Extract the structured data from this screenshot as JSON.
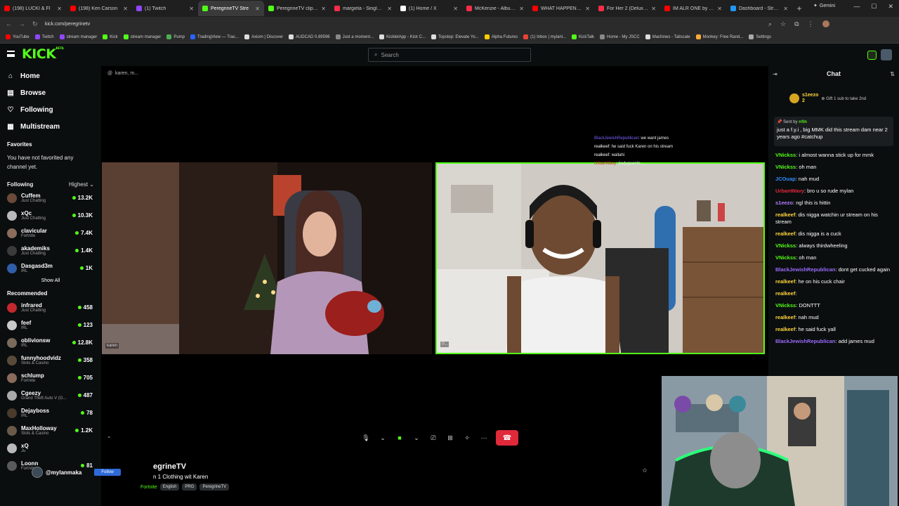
{
  "browser": {
    "tabs": [
      {
        "title": "(198) LUCKI & FI",
        "color": "#ff0000"
      },
      {
        "title": "(198) Ken Carson",
        "color": "#ff0000"
      },
      {
        "title": "(1) Twitch",
        "color": "#9146ff"
      },
      {
        "title": "PeregrineTV Stre",
        "color": "#53fc18",
        "active": true
      },
      {
        "title": "PeregrineTV clipped",
        "color": "#53fc18"
      },
      {
        "title": "margiela - Single - Al",
        "color": "#fa2d48"
      },
      {
        "title": "(1) Home / X",
        "color": "#ffffff"
      },
      {
        "title": "McKenzie - Album by",
        "color": "#fa2d48"
      },
      {
        "title": "WHAT HAPPENED TO",
        "color": "#ff0000"
      },
      {
        "title": "For Her 2 (Deluxe) -",
        "color": "#fa2d48"
      },
      {
        "title": "IM ALR ONE by mylan",
        "color": "#ff0000"
      },
      {
        "title": "Dashboard - Stream",
        "color": "#2196f3"
      }
    ],
    "gemini_label": "Gemini",
    "url": "kick.com/peregrinetv",
    "bookmarks": [
      {
        "label": "YouTube",
        "color": "#ff0000"
      },
      {
        "label": "Twitch",
        "color": "#9146ff"
      },
      {
        "label": "stream manager",
        "color": "#9146ff"
      },
      {
        "label": "Kick",
        "color": "#53fc18"
      },
      {
        "label": "stream manager",
        "color": "#53fc18"
      },
      {
        "label": "Pump",
        "color": "#4caf50"
      },
      {
        "label": "TradingView — Trac...",
        "color": "#2962ff"
      },
      {
        "label": "Axiom | Discover",
        "color": "#dddddd"
      },
      {
        "label": "AUDCAD 0.89596",
        "color": "#dddddd"
      },
      {
        "label": "Just a moment...",
        "color": "#888888"
      },
      {
        "label": "KickletApp - Kick C...",
        "color": "#dddddd"
      },
      {
        "label": "Topstep: Elevate Yo...",
        "color": "#dddddd"
      },
      {
        "label": "Alpha Futures",
        "color": "#ffcc00"
      },
      {
        "label": "(1) Inbox | mylanl...",
        "color": "#ea4335"
      },
      {
        "label": "KickTalk",
        "color": "#53fc18"
      },
      {
        "label": "Home - My JSCC",
        "color": "#888888"
      },
      {
        "label": "Machines - Tailscale",
        "color": "#dddddd"
      },
      {
        "label": "Monkey: Free Rand...",
        "color": "#ffaa33"
      },
      {
        "label": "Settings",
        "color": "#aaaaaa"
      }
    ]
  },
  "header": {
    "logo": "KICK",
    "logo_beta": "BETA",
    "search_placeholder": "Search"
  },
  "sidebar": {
    "nav": [
      {
        "label": "Home",
        "icon": "home-icon"
      },
      {
        "label": "Browse",
        "icon": "browse-icon"
      },
      {
        "label": "Following",
        "icon": "heart-icon"
      },
      {
        "label": "Multistream",
        "icon": "multistream-icon"
      }
    ],
    "favorites_title": "Favorites",
    "favorites_note": "You have not favorited any channel yet.",
    "following_title": "Following",
    "following_sort": "Highest",
    "following": [
      {
        "name": "Cuffem",
        "category": "Just Chatting",
        "viewers": "13.2K",
        "color": "#6b4a3a"
      },
      {
        "name": "xQc",
        "category": "Just Chatting",
        "viewers": "10.3K",
        "color": "#b9b9b9"
      },
      {
        "name": "clavicular",
        "category": "Fortnite",
        "viewers": "7.4K",
        "color": "#8a6d5a"
      },
      {
        "name": "akademiks",
        "category": "Just Chatting",
        "viewers": "1.4K",
        "color": "#3b3b3b"
      },
      {
        "name": "Dasgasd3m",
        "category": "IRL",
        "viewers": "1K",
        "color": "#2f5ea8"
      }
    ],
    "show_all": "Show All",
    "recommended_title": "Recommended",
    "recommended": [
      {
        "name": "infrared",
        "category": "Just Chatting",
        "viewers": "458",
        "color": "#c2282d"
      },
      {
        "name": "feef",
        "category": "IRL",
        "viewers": "123",
        "color": "#c9c9c9"
      },
      {
        "name": "oblivionsw",
        "category": "IRL",
        "viewers": "12.8K",
        "color": "#7a6a5a"
      },
      {
        "name": "funnyhoodvidz",
        "category": "Slots & Casino",
        "viewers": "358",
        "color": "#5a4a3a"
      },
      {
        "name": "schlump",
        "category": "Fortnite",
        "viewers": "705",
        "color": "#8a6a5a"
      },
      {
        "name": "Cgeezy",
        "category": "Grand Theft Auto V (G...",
        "viewers": "487",
        "color": "#aaaaaa"
      },
      {
        "name": "Dejayboss",
        "category": "IRL",
        "viewers": "78",
        "color": "#4a3a2a"
      },
      {
        "name": "MaxHolloway",
        "category": "Slots & Casino",
        "viewers": "1.2K",
        "color": "#6a5a4a"
      },
      {
        "name": "xQ",
        "category": "Ju",
        "viewers": "",
        "color": "#b9b9b9"
      },
      {
        "name": "Loonn",
        "category": "Fortnite",
        "viewers": "81",
        "color": "#5a5a5a"
      }
    ]
  },
  "main": {
    "call_title": "karen, m...",
    "feed_left_label": "karen",
    "feed_right_label": "P...",
    "overlay_chat": [
      {
        "user": "BlackJewishRepublican",
        "text": ": we want james",
        "color": "#7b61ff"
      },
      {
        "user": "realkeef",
        "text": ": he said fuck Karen on his stream",
        "color": "#ffffff"
      },
      {
        "user": "realkeef",
        "text": ": wallahi",
        "color": "#ffffff"
      },
      {
        "user": "UrbanWavy",
        "text": ": bodyguards ...",
        "color": "#e0293a"
      }
    ],
    "streamer_name": "egrineTV",
    "stream_title": "n 1 Clothing wit Karen",
    "category": "Fortnite",
    "tags": [
      "English",
      "PRG",
      "PeregrineTV"
    ],
    "mylan_handle": "@mylanmaka",
    "follow_label": "Follow"
  },
  "chat": {
    "title": "Chat",
    "gift_user": "s1eezo",
    "gift_count": "2",
    "gift_text": "Gift 1 sub to take 2nd",
    "pinned_sent_prefix": "Sent by",
    "pinned_sender": "rr0n",
    "pinned_text": "just a f.y.i , big MMK did this stream dam near 2 years ago #catchup",
    "messages": [
      {
        "user": "VNickss",
        "text": ": i almost wanna stick up for mmk",
        "color": "#53fc18"
      },
      {
        "user": "VNickss",
        "text": ": oh man",
        "color": "#53fc18"
      },
      {
        "user": "JCOuap",
        "text": ": nah mud",
        "color": "#2f8cff"
      },
      {
        "user": "UrbanWavy",
        "text": ": bro u so rude mylan",
        "color": "#e0293a"
      },
      {
        "user": "s1eezo",
        "text": ": ngl this is hittin",
        "color": "#b47cff"
      },
      {
        "user": "realkeef",
        "text": ": dis nigga watchin ur stream on his stream",
        "color": "#ffd43b"
      },
      {
        "user": "realkeef",
        "text": ": dis nigga is a cuck",
        "color": "#ffd43b"
      },
      {
        "user": "VNickss",
        "text": ": always thirdwheeling",
        "color": "#53fc18"
      },
      {
        "user": "VNickss",
        "text": ": oh man",
        "color": "#53fc18"
      },
      {
        "user": "BlackJewishRepublican",
        "text": ": dont get cucked again",
        "color": "#9b6bff"
      },
      {
        "user": "realkeef",
        "text": ": he on his cuck chair",
        "color": "#ffd43b"
      },
      {
        "user": "realkeef",
        "text": ":",
        "color": "#ffd43b"
      },
      {
        "user": "VNickss",
        "text": ": DONTTT",
        "color": "#53fc18"
      },
      {
        "user": "realkeef",
        "text": ": nah mud",
        "color": "#ffd43b"
      },
      {
        "user": "realkeef",
        "text": ": he said fuck yall",
        "color": "#ffd43b"
      },
      {
        "user": "BlackJewishRepublican",
        "text": ": add james mud",
        "color": "#9b6bff"
      }
    ]
  }
}
